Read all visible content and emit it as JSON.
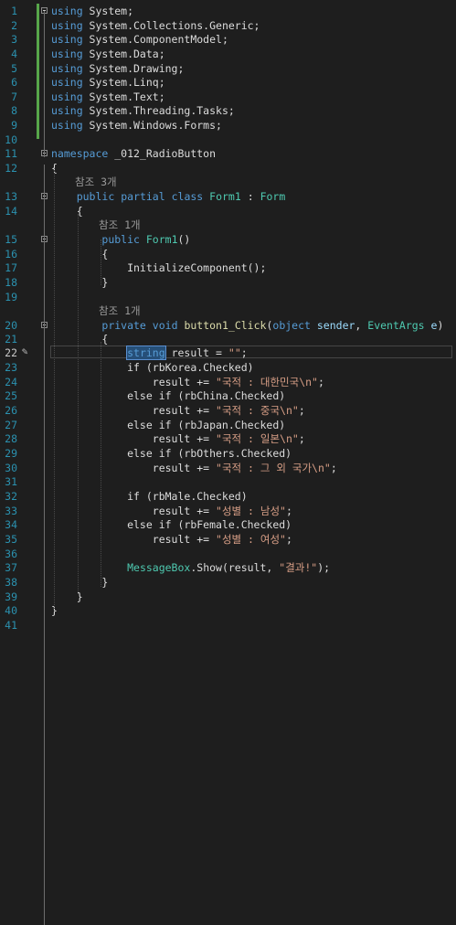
{
  "editor": {
    "line_numbers": [
      "1",
      "2",
      "3",
      "4",
      "5",
      "6",
      "7",
      "8",
      "9",
      "10",
      "11",
      "12",
      "13",
      "14",
      "15",
      "16",
      "17",
      "18",
      "19",
      "20",
      "21",
      "22",
      "23",
      "24",
      "25",
      "26",
      "27",
      "28",
      "29",
      "30",
      "31",
      "32",
      "33",
      "34",
      "35",
      "36",
      "37",
      "38",
      "39",
      "40",
      "41"
    ],
    "active_line": "22",
    "lines": [
      [
        {
          "t": "using",
          "c": "kw"
        },
        {
          "t": " System;",
          "c": "pl"
        }
      ],
      [
        {
          "t": "using",
          "c": "kw"
        },
        {
          "t": " System.Collections.Generic;",
          "c": "pl"
        }
      ],
      [
        {
          "t": "using",
          "c": "kw"
        },
        {
          "t": " System.ComponentModel;",
          "c": "pl"
        }
      ],
      [
        {
          "t": "using",
          "c": "kw"
        },
        {
          "t": " System.Data;",
          "c": "pl"
        }
      ],
      [
        {
          "t": "using",
          "c": "kw"
        },
        {
          "t": " System.Drawing;",
          "c": "pl"
        }
      ],
      [
        {
          "t": "using",
          "c": "kw"
        },
        {
          "t": " System.Linq;",
          "c": "pl"
        }
      ],
      [
        {
          "t": "using",
          "c": "kw"
        },
        {
          "t": " System.Text;",
          "c": "pl"
        }
      ],
      [
        {
          "t": "using",
          "c": "kw"
        },
        {
          "t": " System.Threading.Tasks;",
          "c": "pl"
        }
      ],
      [
        {
          "t": "using",
          "c": "kw"
        },
        {
          "t": " System.Windows.Forms;",
          "c": "pl"
        }
      ],
      [],
      [
        {
          "t": "namespace",
          "c": "kw"
        },
        {
          "t": " _012_RadioButton",
          "c": "pl"
        }
      ],
      [
        {
          "t": "{",
          "c": "pl"
        }
      ],
      [
        {
          "t": "    ",
          "c": "pl"
        },
        {
          "t": "public",
          "c": "kw"
        },
        {
          "t": " ",
          "c": "pl"
        },
        {
          "t": "partial",
          "c": "kw"
        },
        {
          "t": " ",
          "c": "pl"
        },
        {
          "t": "class",
          "c": "kw"
        },
        {
          "t": " ",
          "c": "pl"
        },
        {
          "t": "Form1",
          "c": "ty"
        },
        {
          "t": " : ",
          "c": "pl"
        },
        {
          "t": "Form",
          "c": "ty"
        }
      ],
      [
        {
          "t": "    {",
          "c": "pl"
        }
      ],
      [
        {
          "t": "        ",
          "c": "pl"
        },
        {
          "t": "public",
          "c": "kw"
        },
        {
          "t": " ",
          "c": "pl"
        },
        {
          "t": "Form1",
          "c": "ty"
        },
        {
          "t": "()",
          "c": "pl"
        }
      ],
      [
        {
          "t": "        {",
          "c": "pl"
        }
      ],
      [
        {
          "t": "            InitializeComponent();",
          "c": "pl"
        }
      ],
      [
        {
          "t": "        }",
          "c": "pl"
        }
      ],
      [],
      [
        {
          "t": "        ",
          "c": "pl"
        },
        {
          "t": "private",
          "c": "kw"
        },
        {
          "t": " ",
          "c": "pl"
        },
        {
          "t": "void",
          "c": "kw"
        },
        {
          "t": " ",
          "c": "pl"
        },
        {
          "t": "button1_Click",
          "c": "fn"
        },
        {
          "t": "(",
          "c": "pl"
        },
        {
          "t": "object",
          "c": "kw"
        },
        {
          "t": " ",
          "c": "pl"
        },
        {
          "t": "sender",
          "c": "pm"
        },
        {
          "t": ", ",
          "c": "pl"
        },
        {
          "t": "EventArgs",
          "c": "ty"
        },
        {
          "t": " ",
          "c": "pl"
        },
        {
          "t": "e",
          "c": "pm"
        },
        {
          "t": ")",
          "c": "pl"
        }
      ],
      [
        {
          "t": "        {",
          "c": "pl"
        }
      ],
      [
        {
          "t": "            ",
          "c": "pl"
        },
        {
          "t": "string",
          "c": "kw hl"
        },
        {
          "t": " result = ",
          "c": "pl"
        },
        {
          "t": "\"\"",
          "c": "str"
        },
        {
          "t": ";",
          "c": "pl"
        }
      ],
      [
        {
          "t": "            if (rbKorea.Checked)",
          "c": "pl"
        }
      ],
      [
        {
          "t": "                result += ",
          "c": "pl"
        },
        {
          "t": "\"국적 : 대한민국\\n\"",
          "c": "str"
        },
        {
          "t": ";",
          "c": "pl"
        }
      ],
      [
        {
          "t": "            else if (rbChina.Checked)",
          "c": "pl"
        }
      ],
      [
        {
          "t": "                result += ",
          "c": "pl"
        },
        {
          "t": "\"국적 : 중국\\n\"",
          "c": "str"
        },
        {
          "t": ";",
          "c": "pl"
        }
      ],
      [
        {
          "t": "            else if (rbJapan.Checked)",
          "c": "pl"
        }
      ],
      [
        {
          "t": "                result += ",
          "c": "pl"
        },
        {
          "t": "\"국적 : 일본\\n\"",
          "c": "str"
        },
        {
          "t": ";",
          "c": "pl"
        }
      ],
      [
        {
          "t": "            else if (rbOthers.Checked)",
          "c": "pl"
        }
      ],
      [
        {
          "t": "                result += ",
          "c": "pl"
        },
        {
          "t": "\"국적 : 그 외 국가\\n\"",
          "c": "str"
        },
        {
          "t": ";",
          "c": "pl"
        }
      ],
      [],
      [
        {
          "t": "            if (rbMale.Checked)",
          "c": "pl"
        }
      ],
      [
        {
          "t": "                result += ",
          "c": "pl"
        },
        {
          "t": "\"성별 : 남성\"",
          "c": "str"
        },
        {
          "t": ";",
          "c": "pl"
        }
      ],
      [
        {
          "t": "            else if (rbFemale.Checked)",
          "c": "pl"
        }
      ],
      [
        {
          "t": "                result += ",
          "c": "pl"
        },
        {
          "t": "\"성별 : 여성\"",
          "c": "str"
        },
        {
          "t": ";",
          "c": "pl"
        }
      ],
      [],
      [
        {
          "t": "            ",
          "c": "pl"
        },
        {
          "t": "MessageBox",
          "c": "ty"
        },
        {
          "t": ".Show(result, ",
          "c": "pl"
        },
        {
          "t": "\"결과!\"",
          "c": "str"
        },
        {
          "t": ");",
          "c": "pl"
        }
      ],
      [
        {
          "t": "        }",
          "c": "pl"
        }
      ],
      [
        {
          "t": "    }",
          "c": "pl"
        }
      ],
      [
        {
          "t": "}",
          "c": "pl"
        }
      ],
      []
    ],
    "reference_lenses": [
      {
        "before_line": 13,
        "text": "참조 3개"
      },
      {
        "before_line": 15,
        "text": "참조 1개"
      },
      {
        "before_line": 20,
        "text": "참조 1개"
      }
    ],
    "collapsible_lines": [
      1,
      11,
      13,
      15,
      20
    ],
    "colors": {
      "background": "#1e1e1e",
      "keyword": "#569cd6",
      "type": "#4ec9b0",
      "string": "#d69d85",
      "line_number": "#2b91af"
    }
  }
}
